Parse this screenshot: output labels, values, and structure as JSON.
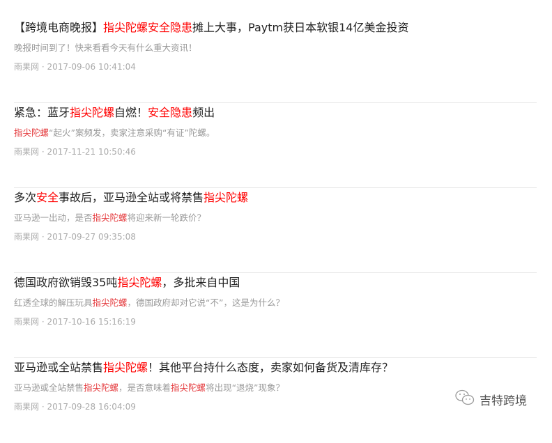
{
  "items": [
    {
      "title": [
        {
          "t": "【跨境电商晚报】",
          "hl": false
        },
        {
          "t": "指尖陀螺安全隐患",
          "hl": true
        },
        {
          "t": "摊上大事，Paytm获日本软银14亿美金投资",
          "hl": false
        }
      ],
      "desc": [
        {
          "t": "晚报时间到了！快来看看今天有什么重大资讯！",
          "hl": false
        }
      ],
      "meta": "雨果网 · 2017-09-06 10:41:04"
    },
    {
      "title": [
        {
          "t": "紧急：蓝牙",
          "hl": false
        },
        {
          "t": "指尖陀螺",
          "hl": true
        },
        {
          "t": "自燃！",
          "hl": false
        },
        {
          "t": "安全隐患",
          "hl": true
        },
        {
          "t": "频出",
          "hl": false
        }
      ],
      "desc": [
        {
          "t": "指尖陀螺",
          "hl": true
        },
        {
          "t": "“起火”案频发，卖家注意采购“有证”陀螺。",
          "hl": false
        }
      ],
      "meta": "雨果网 · 2017-11-21 10:50:46"
    },
    {
      "title": [
        {
          "t": "多次",
          "hl": false
        },
        {
          "t": "安全",
          "hl": true
        },
        {
          "t": "事故后，亚马逊全站或将禁售",
          "hl": false
        },
        {
          "t": "指尖陀螺",
          "hl": true
        }
      ],
      "desc": [
        {
          "t": "亚马逊一出动，是否",
          "hl": false
        },
        {
          "t": "指尖陀螺",
          "hl": true
        },
        {
          "t": "将迎来新一轮跌价？",
          "hl": false
        }
      ],
      "meta": "雨果网 · 2017-09-27 09:35:08"
    },
    {
      "title": [
        {
          "t": "德国政府欲销毁35吨",
          "hl": false
        },
        {
          "t": "指尖陀螺",
          "hl": true
        },
        {
          "t": "，多批来自中国",
          "hl": false
        }
      ],
      "desc": [
        {
          "t": "红透全球的解压玩具",
          "hl": false
        },
        {
          "t": "指尖陀螺",
          "hl": true
        },
        {
          "t": "，德国政府却对它说“不”，这是为什么？",
          "hl": false
        }
      ],
      "meta": "雨果网 · 2017-10-16 15:16:19"
    },
    {
      "title": [
        {
          "t": "亚马逊或全站禁售",
          "hl": false
        },
        {
          "t": "指尖陀螺",
          "hl": true
        },
        {
          "t": "！其他平台持什么态度，卖家如何备货及清库存？",
          "hl": false
        }
      ],
      "desc": [
        {
          "t": "亚马逊或全站禁售",
          "hl": false
        },
        {
          "t": "指尖陀螺",
          "hl": true
        },
        {
          "t": "，是否意味着",
          "hl": false
        },
        {
          "t": "指尖陀螺",
          "hl": true
        },
        {
          "t": "将出现“退烧”现象？",
          "hl": false
        }
      ],
      "meta": "雨果网 · 2017-09-28 16:04:09"
    }
  ],
  "watermark": {
    "icon": "wechat-icon",
    "text": "吉特跨境"
  },
  "colors": {
    "highlight": "#ff0000",
    "title": "#222222",
    "desc": "#999999",
    "meta": "#aaaaaa"
  }
}
